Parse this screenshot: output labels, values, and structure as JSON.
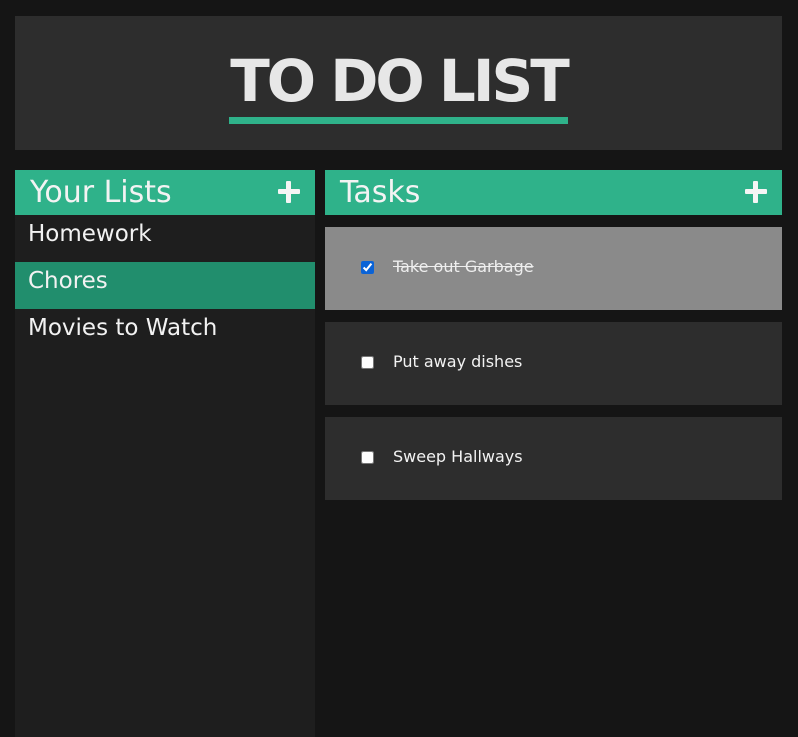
{
  "header": {
    "title": "TO DO LIST"
  },
  "lists_panel": {
    "title": "Your Lists",
    "add_icon": "plus-icon",
    "items": [
      {
        "label": "Homework",
        "active": false
      },
      {
        "label": "Chores",
        "active": true
      },
      {
        "label": "Movies to Watch",
        "active": false
      }
    ]
  },
  "tasks_panel": {
    "title": "Tasks",
    "add_icon": "plus-icon",
    "tasks": [
      {
        "label": "Take out Garbage",
        "done": true
      },
      {
        "label": "Put away dishes",
        "done": false
      },
      {
        "label": "Sweep Hallways",
        "done": false
      }
    ]
  },
  "colors": {
    "accent": "#2fb28a",
    "active_list": "#218e6d",
    "background": "#151515",
    "panel": "#2d2d2d",
    "done_task": "#8a8a8a"
  }
}
